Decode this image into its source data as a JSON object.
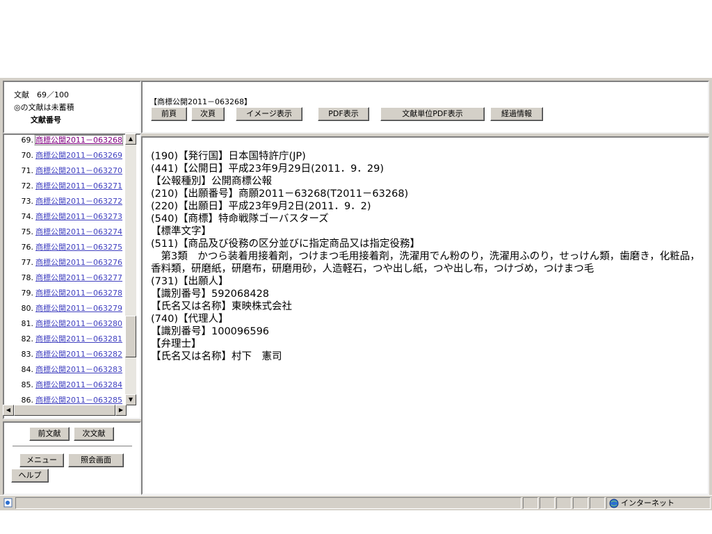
{
  "left_top": {
    "doc_count": "文献　69／100",
    "note": "◎の文献は未蓄積",
    "label": "文献番号"
  },
  "header": {
    "doc_title": "【商標公開2011－063268】",
    "buttons": {
      "prev_page": "前頁",
      "next_page": "次頁",
      "image_view": "イメージ表示",
      "pdf_view": "PDF表示",
      "doc_pdf_view": "文献単位PDF表示",
      "history": "経過情報"
    }
  },
  "doc_list": [
    {
      "num": "69.",
      "label": "商標公開2011－063268",
      "selected": true
    },
    {
      "num": "70.",
      "label": "商標公開2011－063269"
    },
    {
      "num": "71.",
      "label": "商標公開2011－063270"
    },
    {
      "num": "72.",
      "label": "商標公開2011－063271"
    },
    {
      "num": "73.",
      "label": "商標公開2011－063272"
    },
    {
      "num": "74.",
      "label": "商標公開2011－063273"
    },
    {
      "num": "75.",
      "label": "商標公開2011－063274"
    },
    {
      "num": "76.",
      "label": "商標公開2011－063275"
    },
    {
      "num": "77.",
      "label": "商標公開2011－063276"
    },
    {
      "num": "78.",
      "label": "商標公開2011－063277"
    },
    {
      "num": "79.",
      "label": "商標公開2011－063278"
    },
    {
      "num": "80.",
      "label": "商標公開2011－063279"
    },
    {
      "num": "81.",
      "label": "商標公開2011－063280"
    },
    {
      "num": "82.",
      "label": "商標公開2011－063281"
    },
    {
      "num": "83.",
      "label": "商標公開2011－063282"
    },
    {
      "num": "84.",
      "label": "商標公開2011－063283"
    },
    {
      "num": "85.",
      "label": "商標公開2011－063284"
    },
    {
      "num": "86.",
      "label": "商標公開2011－063285"
    }
  ],
  "nav_buttons": {
    "prev_doc": "前文献",
    "next_doc": "次文献",
    "menu": "メニュー",
    "inquiry": "照会画面",
    "help": "ヘルプ"
  },
  "document_lines": [
    "(190)【発行国】日本国特許庁(JP)",
    "(441)【公開日】平成23年9月29日(2011．9．29)",
    "【公報種別】公開商標公報",
    "(210)【出願番号】商願2011－63268(T2011－63268)",
    "(220)【出願日】平成23年9月2日(2011．9．2)",
    "(540)【商標】特命戦隊ゴーバスターズ",
    "【標準文字】",
    "(511)【商品及び役務の区分並びに指定商品又は指定役務】",
    "　第3類　かつら装着用接着剤，つけまつ毛用接着剤，洗濯用でん粉のり，洗濯用ふのり，せっけん類，歯磨き，化粧品，香料類，研磨紙，研磨布，研磨用砂，人造軽石，つや出し紙，つや出し布，つけづめ，つけまつ毛",
    "(731)【出願人】",
    "【識別番号】592068428",
    "【氏名又は名称】東映株式会社",
    "(740)【代理人】",
    "【識別番号】100096596",
    "【弁理士】",
    "【氏名又は名称】村下　憲司"
  ],
  "status_bar": {
    "zone": "インターネット"
  }
}
